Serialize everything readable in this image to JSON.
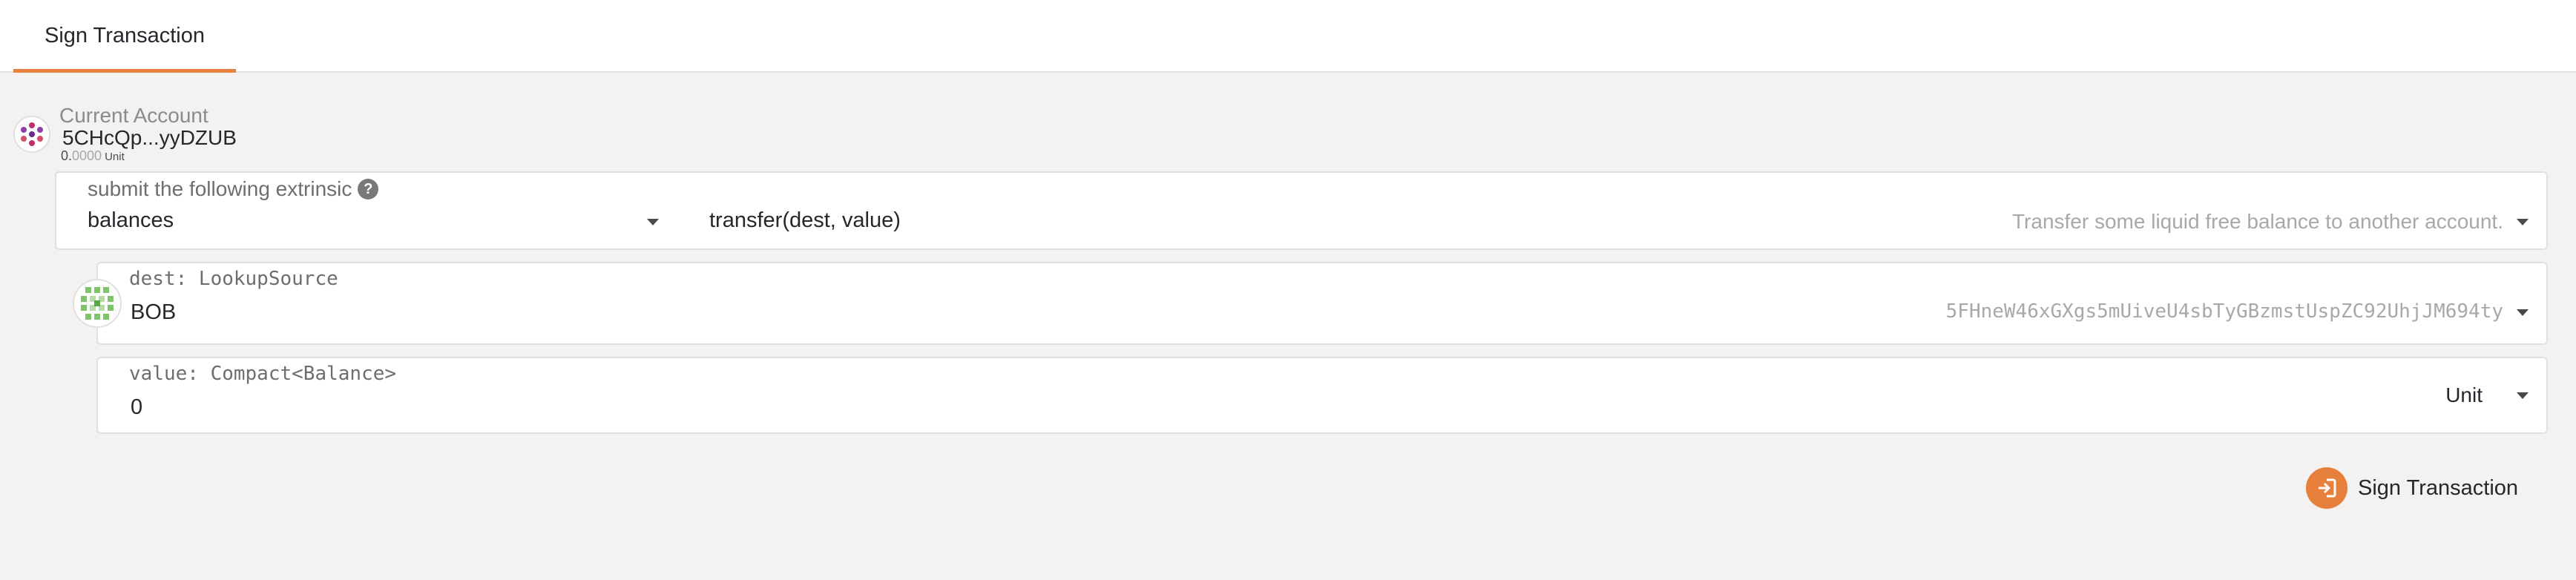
{
  "tabs": [
    {
      "label": "Sign Transaction",
      "active": true
    }
  ],
  "current_account": {
    "label": "Current Account",
    "address_short": "5CHcQp...yyDZUB",
    "balance_int": "0.",
    "balance_dec": "0000",
    "balance_unit": "Unit"
  },
  "extrinsic": {
    "label": "submit the following extrinsic",
    "help_icon": "question-circle-icon",
    "section": "balances",
    "method": "transfer(dest, value)",
    "method_description": "Transfer some liquid free balance to another account."
  },
  "params": {
    "dest": {
      "label": "dest: LookupSource",
      "account_name": "BOB",
      "address": "5FHneW46xGXgs5mUiveU4sbTyGBzmstUspZC92UhjJM694ty"
    },
    "value": {
      "label": "value: Compact<Balance>",
      "amount": "0",
      "unit": "Unit"
    }
  },
  "actions": {
    "sign_label": "Sign Transaction"
  },
  "colors": {
    "accent": "#e7803c",
    "background": "#f3f2f1",
    "panel": "#ffffff"
  }
}
